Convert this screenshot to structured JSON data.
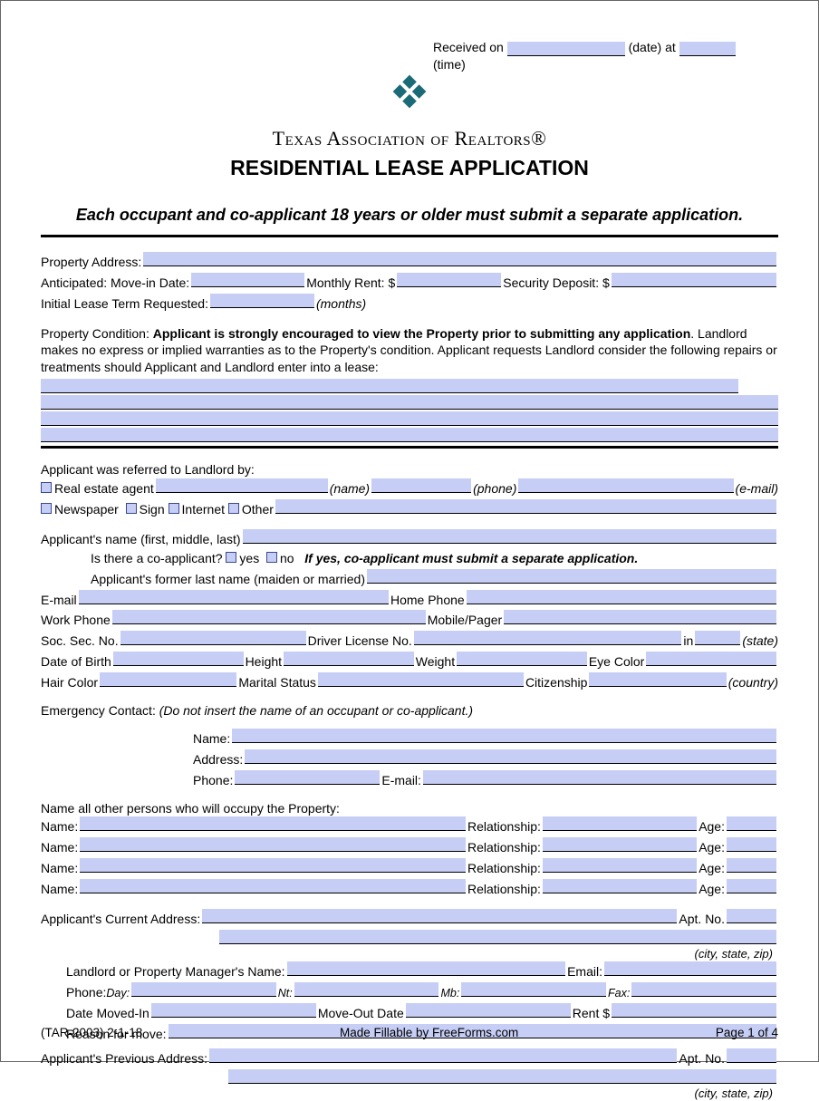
{
  "received": {
    "label1": "Received on",
    "label2": "(date) at",
    "label3": "(time)"
  },
  "header": {
    "org": "Texas Association of Realtors®",
    "title": "RESIDENTIAL LEASE APPLICATION"
  },
  "notice": "Each occupant and co-applicant 18 years or older must submit a separate application.",
  "property": {
    "address": "Property Address:",
    "anticipated": "Anticipated:  Move-in Date:",
    "rent": "Monthly Rent: $",
    "deposit": "Security Deposit: $",
    "term": "Initial Lease Term Requested:",
    "months": "(months)"
  },
  "condition": {
    "lead": "Property Condition: ",
    "bold": "Applicant is strongly encouraged to view the Property prior to submitting any application",
    "rest": ". Landlord makes no express or implied warranties as to the Property's condition. Applicant requests Landlord consider the following repairs or treatments should Applicant and Landlord enter into a lease:"
  },
  "referral": {
    "intro": "Applicant was referred to Landlord by:",
    "agent": "Real estate agent",
    "name": "(name)",
    "phone": "(phone)",
    "email": "(e-mail)",
    "newspaper": "Newspaper",
    "sign": "Sign",
    "internet": "Internet",
    "other": "Other"
  },
  "applicant": {
    "name": "Applicant's name (first, middle, last)",
    "coapp": "Is there a co-applicant?",
    "yes": "yes",
    "no": "no",
    "coappnote": "If yes, co-applicant must submit a separate application.",
    "former": "Applicant's former last name (maiden or married)",
    "email": "E-mail",
    "homephone": "Home Phone",
    "workphone": "Work Phone",
    "mobile": "Mobile/Pager",
    "ssn": "Soc. Sec. No.",
    "dl": "Driver License No.",
    "in": "in",
    "state": "(state)",
    "dob": "Date of Birth",
    "height": "Height",
    "weight": "Weight",
    "eye": "Eye Color",
    "hair": "Hair Color",
    "marital": "Marital Status",
    "citizen": "Citizenship",
    "country": "(country)"
  },
  "emergency": {
    "label": "Emergency Contact:",
    "note": "(Do not insert the name of an occupant or co-applicant.)",
    "name": "Name:",
    "address": "Address:",
    "phone": "Phone:",
    "email": "E-mail:"
  },
  "occupants": {
    "intro": "Name all other persons who will occupy the Property:",
    "name": "Name:",
    "rel": "Relationship:",
    "age": "Age:"
  },
  "current": {
    "label": "Applicant's Current Address:",
    "apt": "Apt. No.",
    "csz": "(city, state, zip)",
    "mgr": "Landlord or Property Manager's Name:",
    "email": "Email:",
    "phone": "Phone:",
    "day": "Day:",
    "nt": "Nt:",
    "mb": "Mb:",
    "fax": "Fax:",
    "movedin": "Date Moved-In",
    "moveout": "Move-Out Date",
    "rent": "Rent $",
    "reason": "Reason for move:"
  },
  "previous": {
    "label": "Applicant's Previous Address:",
    "apt": "Apt. No.",
    "csz": "(city, state, zip)"
  },
  "footer": {
    "left": "(TAR-2003) 2-1-18",
    "center": "Made Fillable by FreeForms.com",
    "right": "Page 1 of 4"
  }
}
